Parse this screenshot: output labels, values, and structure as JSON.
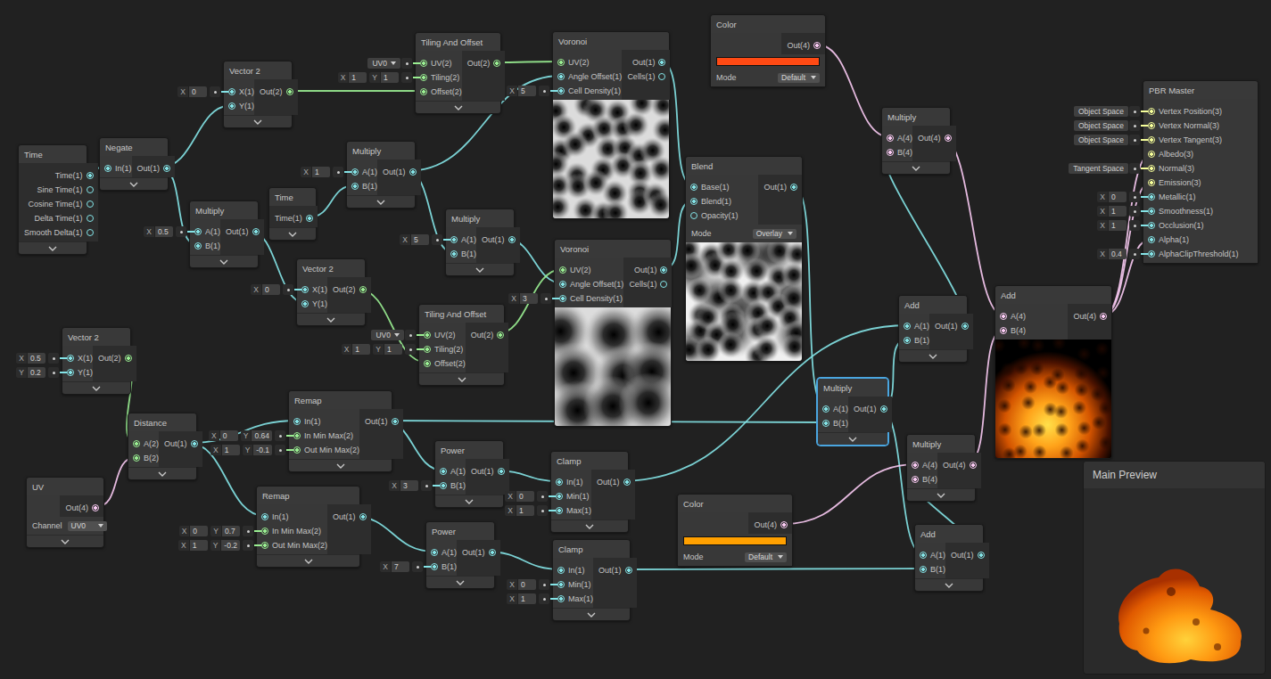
{
  "nodes": [
    {
      "title": "Time",
      "selected": false,
      "inputs": [],
      "outputs": [
        "Time(1)",
        "Sine Time(1)",
        "Cosine Time(1)",
        "Delta Time(1)",
        "Smooth Delta(1)"
      ]
    },
    {
      "title": "Negate",
      "selected": false,
      "inputs": [
        {
          "label": "In(1)"
        }
      ],
      "outputs": [
        "Out(1)"
      ]
    },
    {
      "title": "Vector 2",
      "selected": false,
      "inputs": [
        {
          "label": "X(1)",
          "field": {
            "kind": "vector",
            "parts": [
              {
                "axis": "X",
                "value": "0"
              }
            ]
          }
        },
        {
          "label": "Y(1)"
        }
      ],
      "outputs": [
        "Out(2)"
      ]
    },
    {
      "title": "Tiling And Offset",
      "selected": false,
      "inputs": [
        {
          "label": "UV(2)",
          "field": {
            "kind": "dropdown",
            "value": "UV0"
          }
        },
        {
          "label": "Tiling(2)",
          "field": {
            "kind": "vector",
            "parts": [
              {
                "axis": "X",
                "value": "1"
              },
              {
                "axis": "Y",
                "value": "1"
              }
            ]
          }
        },
        {
          "label": "Offset(2)"
        }
      ],
      "outputs": [
        "Out(2)"
      ]
    },
    {
      "title": "Voronoi",
      "selected": false,
      "inputs": [
        {
          "label": "UV(2)"
        },
        {
          "label": "Angle Offset(1)"
        },
        {
          "label": "Cell Density(1)",
          "field": {
            "kind": "vector",
            "parts": [
              {
                "axis": "X",
                "value": "5"
              }
            ]
          }
        }
      ],
      "outputs": [
        "Out(1)",
        "Cells(1)"
      ],
      "preview": "voronoi-dense"
    },
    {
      "title": "Color",
      "selected": false,
      "inputs": [],
      "outputs": [
        "Out(4)"
      ],
      "color": "#ff4a14",
      "mode": {
        "label": "Mode",
        "value": "Default"
      }
    },
    {
      "title": "Multiply",
      "selected": false,
      "inputs": [
        {
          "label": "A(4)"
        },
        {
          "label": "B(4)"
        }
      ],
      "outputs": [
        "Out(4)"
      ]
    },
    {
      "title": "PBR Master",
      "selected": false,
      "inputs": [
        {
          "label": "Vertex Position(3)",
          "field": {
            "kind": "space",
            "value": "Object Space"
          }
        },
        {
          "label": "Vertex Normal(3)",
          "field": {
            "kind": "space",
            "value": "Object Space"
          }
        },
        {
          "label": "Vertex Tangent(3)",
          "field": {
            "kind": "space",
            "value": "Object Space"
          }
        },
        {
          "label": "Albedo(3)"
        },
        {
          "label": "Normal(3)",
          "field": {
            "kind": "space",
            "value": "Tangent Space"
          }
        },
        {
          "label": "Emission(3)"
        },
        {
          "label": "Metallic(1)",
          "field": {
            "kind": "vector",
            "parts": [
              {
                "axis": "X",
                "value": "0"
              }
            ]
          }
        },
        {
          "label": "Smoothness(1)",
          "field": {
            "kind": "vector",
            "parts": [
              {
                "axis": "X",
                "value": "1"
              }
            ]
          }
        },
        {
          "label": "Occlusion(1)",
          "field": {
            "kind": "vector",
            "parts": [
              {
                "axis": "X",
                "value": "1"
              }
            ]
          }
        },
        {
          "label": "Alpha(1)"
        },
        {
          "label": "AlphaClipThreshold(1)",
          "field": {
            "kind": "vector",
            "parts": [
              {
                "axis": "X",
                "value": "0.4"
              }
            ]
          }
        }
      ],
      "outputs": []
    },
    {
      "title": "Multiply",
      "selected": false,
      "inputs": [
        {
          "label": "A(1)",
          "field": {
            "kind": "vector",
            "parts": [
              {
                "axis": "X",
                "value": "1"
              }
            ]
          }
        },
        {
          "label": "B(1)"
        }
      ],
      "outputs": [
        "Out(1)"
      ]
    },
    {
      "title": "Time",
      "selected": false,
      "inputs": [],
      "outputs": [
        "Time(1)"
      ]
    },
    {
      "title": "Multiply",
      "selected": false,
      "inputs": [
        {
          "label": "A(1)",
          "field": {
            "kind": "vector",
            "parts": [
              {
                "axis": "X",
                "value": "0.5"
              }
            ]
          }
        },
        {
          "label": "B(1)"
        }
      ],
      "outputs": [
        "Out(1)"
      ]
    },
    {
      "title": "Multiply",
      "selected": false,
      "inputs": [
        {
          "label": "A(1)",
          "field": {
            "kind": "vector",
            "parts": [
              {
                "axis": "X",
                "value": "5"
              }
            ]
          }
        },
        {
          "label": "B(1)"
        }
      ],
      "outputs": [
        "Out(1)"
      ]
    },
    {
      "title": "Blend",
      "selected": false,
      "inputs": [
        {
          "label": "Base(1)"
        },
        {
          "label": "Blend(1)"
        },
        {
          "label": "Opacity(1)"
        }
      ],
      "outputs": [
        "Out(1)"
      ],
      "mode": {
        "label": "Mode",
        "value": "Overlay"
      },
      "preview": "blend"
    },
    {
      "title": "Vector 2",
      "selected": false,
      "inputs": [
        {
          "label": "X(1)",
          "field": {
            "kind": "vector",
            "parts": [
              {
                "axis": "X",
                "value": "0"
              }
            ]
          }
        },
        {
          "label": "Y(1)"
        }
      ],
      "outputs": [
        "Out(2)"
      ]
    },
    {
      "title": "Voronoi",
      "selected": false,
      "inputs": [
        {
          "label": "UV(2)"
        },
        {
          "label": "Angle Offset(1)"
        },
        {
          "label": "Cell Density(1)",
          "field": {
            "kind": "vector",
            "parts": [
              {
                "axis": "X",
                "value": "3"
              }
            ]
          }
        }
      ],
      "outputs": [
        "Out(1)",
        "Cells(1)"
      ],
      "preview": "voronoi-sparse"
    },
    {
      "title": "Tiling And Offset",
      "selected": false,
      "inputs": [
        {
          "label": "UV(2)",
          "field": {
            "kind": "dropdown",
            "value": "UV0"
          }
        },
        {
          "label": "Tiling(2)",
          "field": {
            "kind": "vector",
            "parts": [
              {
                "axis": "X",
                "value": "1"
              },
              {
                "axis": "Y",
                "value": "1"
              }
            ]
          }
        },
        {
          "label": "Offset(2)"
        }
      ],
      "outputs": [
        "Out(2)"
      ]
    },
    {
      "title": "Vector 2",
      "selected": false,
      "inputs": [
        {
          "label": "X(1)",
          "field": {
            "kind": "vector",
            "parts": [
              {
                "axis": "X",
                "value": "0.5"
              }
            ]
          }
        },
        {
          "label": "Y(1)",
          "field": {
            "kind": "vector",
            "parts": [
              {
                "axis": "Y",
                "value": "0.2"
              }
            ]
          }
        }
      ],
      "outputs": [
        "Out(2)"
      ]
    },
    {
      "title": "Distance",
      "selected": false,
      "inputs": [
        {
          "label": "A(2)"
        },
        {
          "label": "B(2)"
        }
      ],
      "outputs": [
        "Out(1)"
      ]
    },
    {
      "title": "UV",
      "selected": false,
      "inputs": [],
      "outputs": [
        "Out(4)"
      ],
      "mode": {
        "label": "Channel",
        "value": "UV0"
      }
    },
    {
      "title": "Remap",
      "selected": false,
      "inputs": [
        {
          "label": "In(1)"
        },
        {
          "label": "In Min Max(2)",
          "field": {
            "kind": "vector",
            "parts": [
              {
                "axis": "X",
                "value": "0"
              },
              {
                "axis": "Y",
                "value": "0.64"
              }
            ]
          }
        },
        {
          "label": "Out Min Max(2)",
          "field": {
            "kind": "vector",
            "parts": [
              {
                "axis": "X",
                "value": "1"
              },
              {
                "axis": "Y",
                "value": "-0.1"
              }
            ]
          }
        }
      ],
      "outputs": [
        "Out(1)"
      ]
    },
    {
      "title": "Power",
      "selected": false,
      "inputs": [
        {
          "label": "A(1)"
        },
        {
          "label": "B(1)",
          "field": {
            "kind": "vector",
            "parts": [
              {
                "axis": "X",
                "value": "3"
              }
            ]
          }
        }
      ],
      "outputs": [
        "Out(1)"
      ]
    },
    {
      "title": "Clamp",
      "selected": false,
      "inputs": [
        {
          "label": "In(1)"
        },
        {
          "label": "Min(1)",
          "field": {
            "kind": "vector",
            "parts": [
              {
                "axis": "X",
                "value": "0"
              }
            ]
          }
        },
        {
          "label": "Max(1)",
          "field": {
            "kind": "vector",
            "parts": [
              {
                "axis": "X",
                "value": "1"
              }
            ]
          }
        }
      ],
      "outputs": [
        "Out(1)"
      ]
    },
    {
      "title": "Remap",
      "selected": false,
      "inputs": [
        {
          "label": "In(1)"
        },
        {
          "label": "In Min Max(2)",
          "field": {
            "kind": "vector",
            "parts": [
              {
                "axis": "X",
                "value": "0"
              },
              {
                "axis": "Y",
                "value": "0.7"
              }
            ]
          }
        },
        {
          "label": "Out Min Max(2)",
          "field": {
            "kind": "vector",
            "parts": [
              {
                "axis": "X",
                "value": "1"
              },
              {
                "axis": "Y",
                "value": "-0.2"
              }
            ]
          }
        }
      ],
      "outputs": [
        "Out(1)"
      ]
    },
    {
      "title": "Power",
      "selected": false,
      "inputs": [
        {
          "label": "A(1)"
        },
        {
          "label": "B(1)",
          "field": {
            "kind": "vector",
            "parts": [
              {
                "axis": "X",
                "value": "7"
              }
            ]
          }
        }
      ],
      "outputs": [
        "Out(1)"
      ]
    },
    {
      "title": "Clamp",
      "selected": false,
      "inputs": [
        {
          "label": "In(1)"
        },
        {
          "label": "Min(1)",
          "field": {
            "kind": "vector",
            "parts": [
              {
                "axis": "X",
                "value": "0"
              }
            ]
          }
        },
        {
          "label": "Max(1)",
          "field": {
            "kind": "vector",
            "parts": [
              {
                "axis": "X",
                "value": "1"
              }
            ]
          }
        }
      ],
      "outputs": [
        "Out(1)"
      ]
    },
    {
      "title": "Add",
      "selected": false,
      "inputs": [
        {
          "label": "A(1)"
        },
        {
          "label": "B(1)"
        }
      ],
      "outputs": [
        "Out(1)"
      ]
    },
    {
      "title": "Add",
      "selected": false,
      "inputs": [
        {
          "label": "A(4)"
        },
        {
          "label": "B(4)"
        }
      ],
      "outputs": [
        "Out(4)"
      ],
      "preview": "fire"
    },
    {
      "title": "Multiply",
      "selected": true,
      "inputs": [
        {
          "label": "A(1)"
        },
        {
          "label": "B(1)"
        }
      ],
      "outputs": [
        "Out(1)"
      ]
    },
    {
      "title": "Multiply",
      "selected": false,
      "inputs": [
        {
          "label": "A(4)"
        },
        {
          "label": "B(4)"
        }
      ],
      "outputs": [
        "Out(4)"
      ]
    },
    {
      "title": "Color",
      "selected": false,
      "inputs": [],
      "outputs": [
        "Out(4)"
      ],
      "color": "#ffa000",
      "mode": {
        "label": "Mode",
        "value": "Default"
      }
    },
    {
      "title": "Add",
      "selected": false,
      "inputs": [
        {
          "label": "A(1)"
        },
        {
          "label": "B(1)"
        }
      ],
      "outputs": [
        "Out(1)"
      ]
    }
  ],
  "edges": [
    {
      "from": [
        0,
        0
      ],
      "to": [
        1,
        0
      ]
    },
    {
      "from": [
        1,
        0
      ],
      "to": [
        2,
        1
      ]
    },
    {
      "from": [
        1,
        0
      ],
      "to": [
        10,
        1
      ]
    },
    {
      "from": [
        10,
        0
      ],
      "to": [
        13,
        1
      ]
    },
    {
      "from": [
        2,
        0
      ],
      "to": [
        3,
        2
      ]
    },
    {
      "from": [
        3,
        0
      ],
      "to": [
        4,
        0
      ]
    },
    {
      "from": [
        9,
        0
      ],
      "to": [
        8,
        1
      ]
    },
    {
      "from": [
        8,
        0
      ],
      "to": [
        4,
        1
      ]
    },
    {
      "from": [
        8,
        0
      ],
      "to": [
        11,
        1
      ]
    },
    {
      "from": [
        11,
        0
      ],
      "to": [
        14,
        1
      ]
    },
    {
      "from": [
        13,
        0
      ],
      "to": [
        15,
        2
      ]
    },
    {
      "from": [
        15,
        0
      ],
      "to": [
        14,
        0
      ]
    },
    {
      "from": [
        4,
        0
      ],
      "to": [
        12,
        0
      ]
    },
    {
      "from": [
        14,
        0
      ],
      "to": [
        12,
        1
      ]
    },
    {
      "from": [
        12,
        0
      ],
      "to": [
        27,
        0
      ]
    },
    {
      "from": [
        19,
        0
      ],
      "to": [
        27,
        1
      ]
    },
    {
      "from": [
        19,
        0
      ],
      "to": [
        20,
        0
      ]
    },
    {
      "from": [
        20,
        0
      ],
      "to": [
        21,
        0
      ]
    },
    {
      "from": [
        21,
        0
      ],
      "to": [
        25,
        0
      ]
    },
    {
      "from": [
        27,
        0
      ],
      "to": [
        25,
        1
      ]
    },
    {
      "from": [
        27,
        0
      ],
      "to": [
        30,
        0
      ]
    },
    {
      "from": [
        25,
        0
      ],
      "to": [
        6,
        1
      ]
    },
    {
      "from": [
        5,
        0
      ],
      "to": [
        6,
        0
      ]
    },
    {
      "from": [
        6,
        0
      ],
      "to": [
        26,
        0
      ]
    },
    {
      "from": [
        28,
        0
      ],
      "to": [
        26,
        1
      ]
    },
    {
      "from": [
        29,
        0
      ],
      "to": [
        28,
        0
      ]
    },
    {
      "from": [
        30,
        0
      ],
      "to": [
        28,
        1
      ]
    },
    {
      "from": [
        24,
        0
      ],
      "to": [
        30,
        1
      ]
    },
    {
      "from": [
        26,
        0
      ],
      "to": [
        7,
        3
      ]
    },
    {
      "from": [
        26,
        0
      ],
      "to": [
        7,
        5
      ]
    },
    {
      "from": [
        26,
        0
      ],
      "to": [
        7,
        9
      ]
    },
    {
      "from": [
        18,
        0
      ],
      "to": [
        17,
        1
      ]
    },
    {
      "from": [
        16,
        0
      ],
      "to": [
        17,
        0
      ]
    },
    {
      "from": [
        17,
        0
      ],
      "to": [
        19,
        0
      ]
    },
    {
      "from": [
        17,
        0
      ],
      "to": [
        22,
        0
      ]
    },
    {
      "from": [
        22,
        0
      ],
      "to": [
        23,
        0
      ]
    },
    {
      "from": [
        23,
        0
      ],
      "to": [
        24,
        0
      ]
    }
  ],
  "main_preview": {
    "title": "Main Preview"
  }
}
